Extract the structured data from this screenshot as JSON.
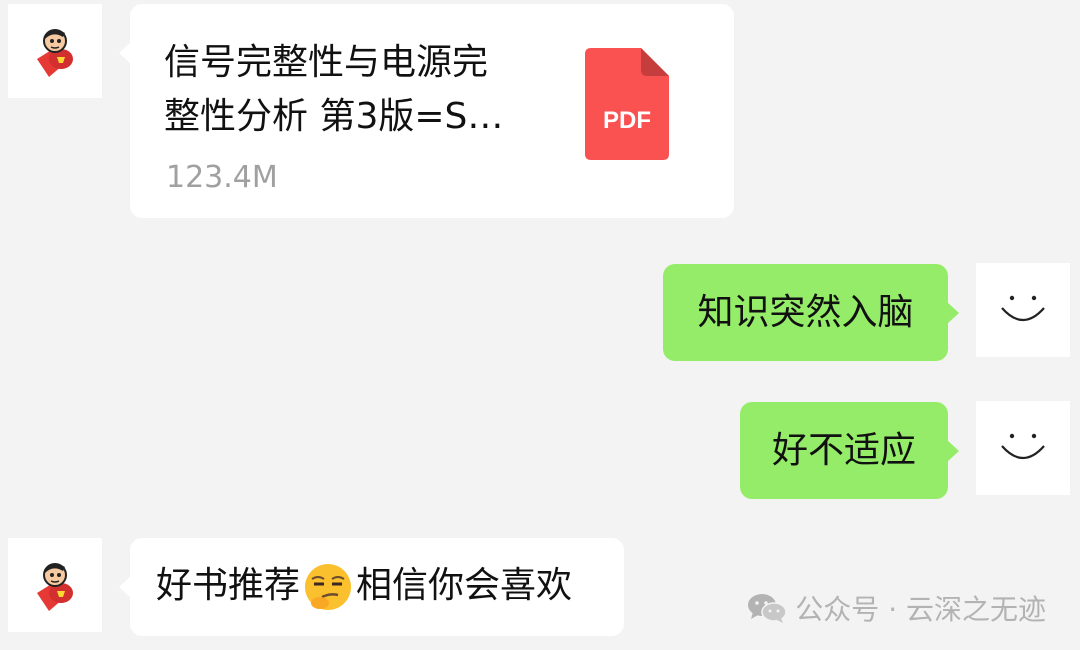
{
  "messages": [
    {
      "type": "file",
      "sender": "other",
      "title_line1": "信号完整性与电源完",
      "title_line2": "整性分析 第3版=S…",
      "size": "123.4M",
      "file_icon_label": "PDF",
      "file_icon_color": "#fa5151"
    },
    {
      "type": "text",
      "sender": "me",
      "text": "知识突然入脑"
    },
    {
      "type": "text",
      "sender": "me",
      "text": "好不适应"
    },
    {
      "type": "text",
      "sender": "other",
      "text_before": "好书推荐",
      "emoji": "smirk-face",
      "text_after": "相信你会喜欢"
    }
  ],
  "watermark": {
    "label": "公众号 · 云深之无迹",
    "icon": "wechat-icon"
  },
  "colors": {
    "background": "#f3f3f3",
    "bubble_self": "#95ec69",
    "bubble_other": "#ffffff"
  }
}
